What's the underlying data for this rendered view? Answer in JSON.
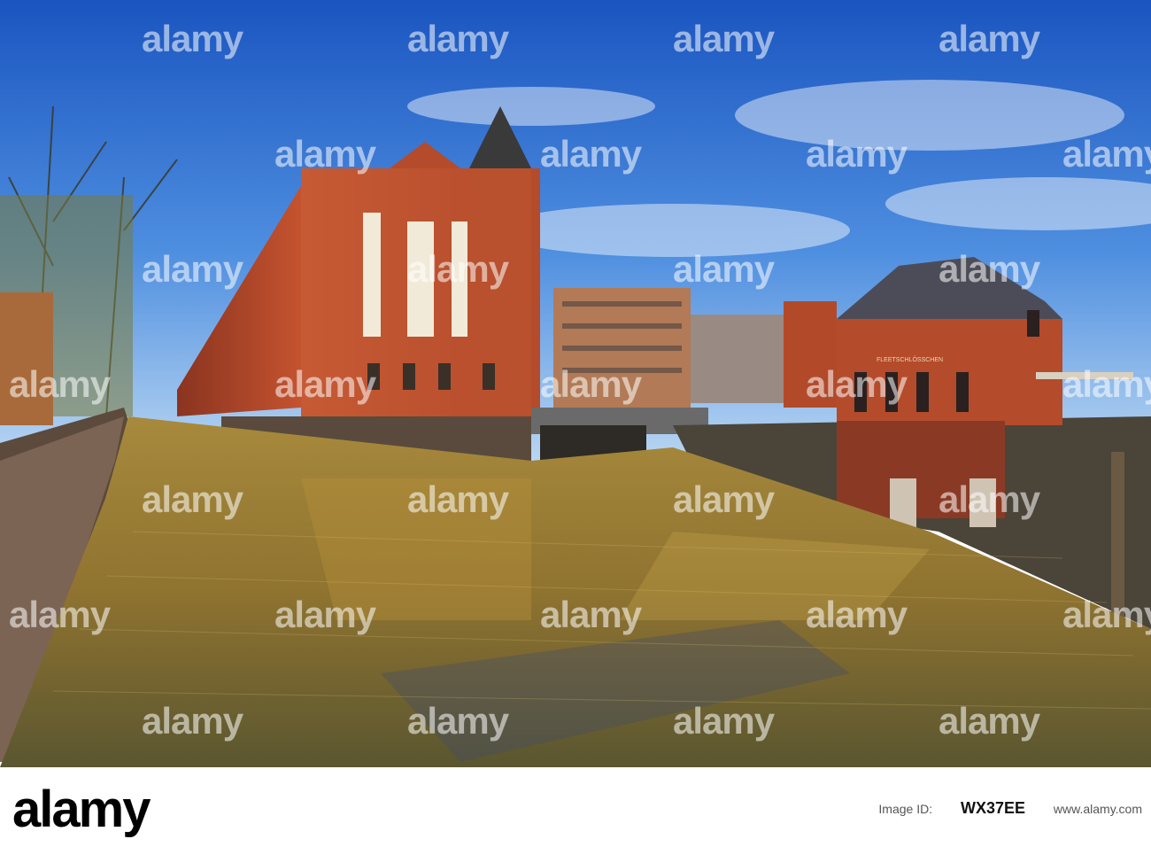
{
  "photo": {
    "description_icon": "canal-warehouse-photo",
    "colors": {
      "sky_top": "#1f5fc4",
      "sky_bottom": "#9cc6ee",
      "brick": "#b8472a",
      "water": "#8a6f2c"
    }
  },
  "sign_text": "FLEETSCHLÖSSCHEN",
  "watermark": {
    "text": "alamy"
  },
  "footer": {
    "logo": "alamy",
    "line_label": "Image ID:",
    "image_id": "WX37EE",
    "url": "www.alamy.com"
  }
}
